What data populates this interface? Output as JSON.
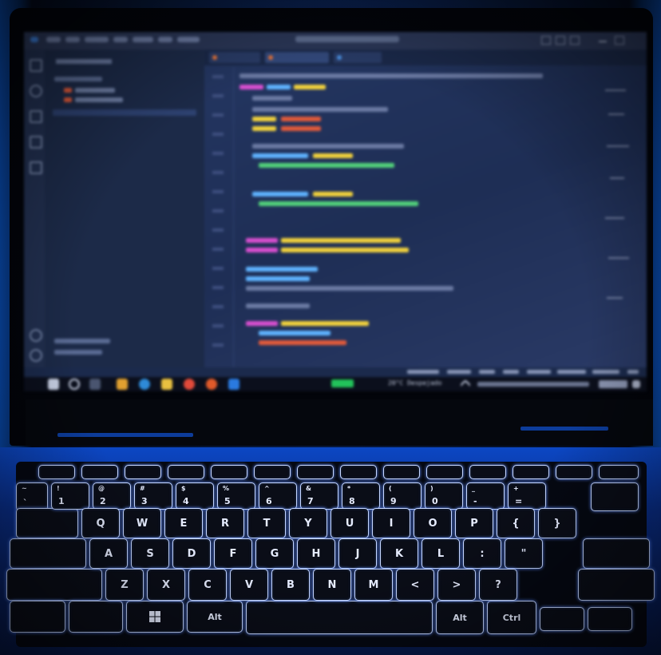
{
  "photo": {
    "subject": "laptop",
    "colors": {
      "deck": "#0c47c4",
      "key_glow": "#c7d7ff",
      "screen_bg": "#1a2a4a",
      "battery": "#22c35a"
    }
  },
  "screen": {
    "editor_ui": "vscode-like",
    "taskbar": {
      "weather": "20°C Despejado"
    }
  },
  "keyboard": {
    "row1": [
      {
        "top": "~",
        "bottom": "`"
      },
      {
        "top": "!",
        "bottom": "1"
      },
      {
        "top": "@",
        "bottom": "2"
      },
      {
        "top": "#",
        "bottom": "3"
      },
      {
        "top": "$",
        "bottom": "4"
      },
      {
        "top": "%",
        "bottom": "5"
      },
      {
        "top": "^",
        "bottom": "6"
      },
      {
        "top": "&",
        "bottom": "7"
      },
      {
        "top": "*",
        "bottom": "8"
      },
      {
        "top": "(",
        "bottom": "9"
      },
      {
        "top": ")",
        "bottom": "0"
      },
      {
        "top": "_",
        "bottom": "-"
      },
      {
        "top": "+",
        "bottom": "="
      }
    ],
    "row2": [
      "Q",
      "W",
      "E",
      "R",
      "T",
      "Y",
      "U",
      "I",
      "O",
      "P",
      "{",
      "}"
    ],
    "row3": [
      "A",
      "S",
      "D",
      "F",
      "G",
      "H",
      "J",
      "K",
      "L",
      ":",
      "\""
    ],
    "row4": [
      "Z",
      "X",
      "C",
      "V",
      "B",
      "N",
      "M",
      "<",
      ">",
      "?"
    ],
    "row5": {
      "alt_left": "Alt",
      "alt_right": "Alt",
      "ctrl_right": "Ctrl"
    }
  }
}
